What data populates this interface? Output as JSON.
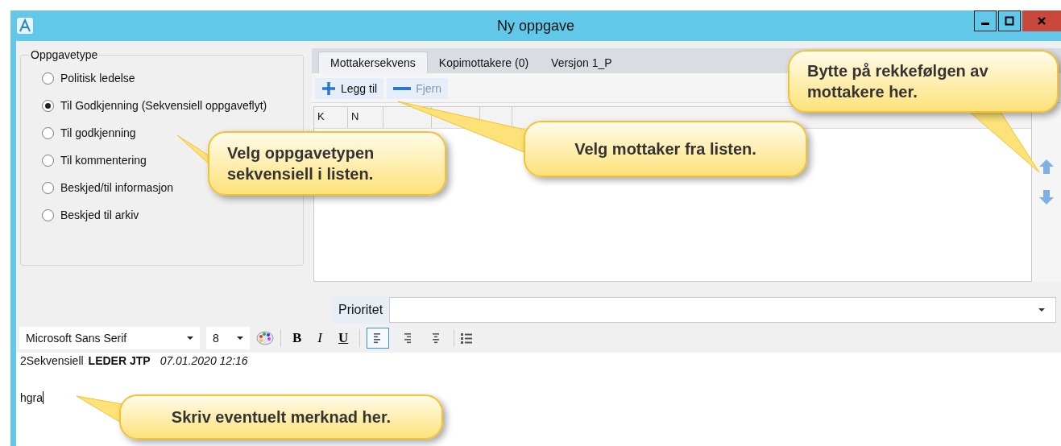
{
  "window": {
    "title": "Ny oppgave"
  },
  "task_type": {
    "legend": "Oppgavetype",
    "options": [
      {
        "label": "Politisk ledelse",
        "selected": false
      },
      {
        "label": "Til Godkjenning (Sekvensiell oppgaveflyt)",
        "selected": true
      },
      {
        "label": "Til godkjenning",
        "selected": false
      },
      {
        "label": "Til kommentering",
        "selected": false
      },
      {
        "label": "Beskjed/til informasjon",
        "selected": false
      },
      {
        "label": "Beskjed til arkiv",
        "selected": false
      }
    ]
  },
  "tabs": [
    {
      "label": "Mottakersekvens",
      "selected": true
    },
    {
      "label": "Kopimottakere (0)",
      "selected": false
    },
    {
      "label": "Versjon 1_P",
      "selected": false
    }
  ],
  "toolbar": [
    {
      "kind": "add",
      "label": "Legg til",
      "disabled": false
    },
    {
      "kind": "remove",
      "label": "Fjern",
      "disabled": true
    }
  ],
  "table": {
    "columns": [
      "K",
      "N"
    ]
  },
  "priority": {
    "label": "Prioritet"
  },
  "format_toolbar": {
    "font": "Microsoft Sans Serif",
    "size": "8",
    "styles": [
      {
        "kind": "bold",
        "label": "B"
      },
      {
        "kind": "italic",
        "label": "I"
      },
      {
        "kind": "underline",
        "label": "U"
      }
    ],
    "align": [
      {
        "kind": "left",
        "selected": true
      },
      {
        "kind": "right",
        "selected": false
      },
      {
        "kind": "center",
        "selected": false
      }
    ]
  },
  "editor": {
    "sender": "2Sekvensiell",
    "name": "LEDER JTP",
    "date": "07.01.2020 12:16",
    "text": "hgra"
  },
  "callouts": [
    {
      "text": "Velg oppgavetypen sekvensiell i listen."
    },
    {
      "text": "Velg mottaker fra listen."
    },
    {
      "text": "Bytte på rekkefølgen av mottakere her."
    },
    {
      "text": "Skriv eventuelt merknad her."
    }
  ]
}
